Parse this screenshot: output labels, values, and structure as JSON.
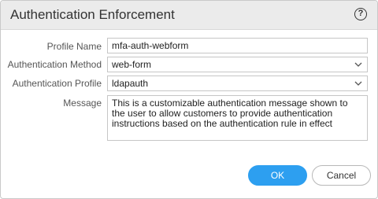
{
  "dialog": {
    "title": "Authentication Enforcement",
    "help_icon": "question-circle-icon",
    "help_glyph": "?"
  },
  "form": {
    "profile_name": {
      "label": "Profile Name",
      "value": "mfa-auth-webform"
    },
    "authentication_method": {
      "label": "Authentication Method",
      "value": "web-form"
    },
    "authentication_profile": {
      "label": "Authentication Profile",
      "value": "ldapauth"
    },
    "message": {
      "label": "Message",
      "value": "This is a customizable authentication message shown to the user to allow customers to provide authentication instructions based on the authentication rule in effect"
    }
  },
  "buttons": {
    "ok_label": "OK",
    "cancel_label": "Cancel"
  },
  "colors": {
    "accent": "#2d9ff0",
    "title_bar": "#ebebeb"
  }
}
